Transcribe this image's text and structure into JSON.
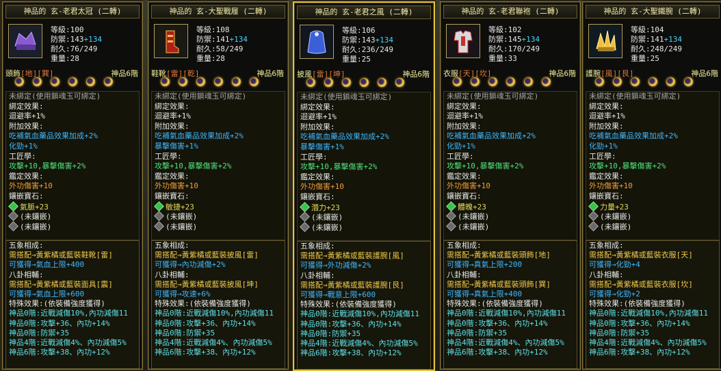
{
  "cards": [
    {
      "title": "神品的 玄-老君太冠 (二轉)",
      "icon": "purple-crown-icon",
      "level": "等級:100",
      "def": "防禦:143",
      "def_plus": "+134",
      "dur": "耐久:76/249",
      "weight": "重量:28",
      "slot": "頭飾",
      "slot_mark": "[地][巽]",
      "tier": "神品6階",
      "unbound": "未綁定(使用鎖魂玉可綁定)",
      "bind_title": "綁定效果:",
      "bind_val": "迴避率+1%",
      "extra_title": "附加效果:",
      "extra_1": "吃補氣血藥品效果加成+2%",
      "extra_2": "化勁+1%",
      "craft_title": "工匠學:",
      "craft_val": "攻擊+10,暴擊傷害+2%",
      "appraise_title": "鑑定效果:",
      "appraise_val": "外功傷害+10",
      "inlay_title": "鑲嵌寶石:",
      "gem1": "氣脈+23",
      "gem2": "(未鑲嵌)",
      "gem3": "(未鑲嵌)",
      "wx_title": "五象相成:",
      "wx_1": "需搭配→黃紫橘或藍裝鞋靴[雷]",
      "wx_2": "可獲得→氣血上限+400",
      "bg_title": "八卦相輔:",
      "bg_1": "需搭配→黃紫橘或藍裝面具[震]",
      "bg_2": "可獲得→氣血上限+600",
      "sp_title": "特殊效果:(依裝備強度獲得)",
      "sp": [
        "神品0階:近戰減傷10%,內功減傷11",
        "神品0階:攻擊+36、內功+14%",
        "神品0階:防禦+35",
        "神品4階:近戰減傷4%、內功減傷5%",
        "神品6階:攻擊+38、內功+12%"
      ]
    },
    {
      "title": "神品的 玄-大聖戰履 (二轉)",
      "icon": "red-boots-icon",
      "level": "等級:108",
      "def": "防禦:141",
      "def_plus": "+134",
      "dur": "耐久:58/249",
      "weight": "重量:28",
      "slot": "鞋靴",
      "slot_mark": "[雷][乾]",
      "tier": "神品6階",
      "unbound": "未綁定(使用鎖魂玉可綁定)",
      "bind_title": "綁定效果:",
      "bind_val": "迴避率+1%",
      "extra_title": "附加效果:",
      "extra_1": "吃補氣血藥品效果加成+2%",
      "extra_2": "暴擊傷害+1%",
      "craft_title": "工匠學:",
      "craft_val": "攻擊+10,暴擊傷害+2%",
      "appraise_title": "鑑定效果:",
      "appraise_val": "外功傷害+10",
      "inlay_title": "鑲嵌寶石:",
      "gem1": "敏捷+23",
      "gem2": "(未鑲嵌)",
      "gem3": "(未鑲嵌)",
      "wx_title": "五象相成:",
      "wx_1": "需搭配→黃紫橘或藍裝披風[雷]",
      "wx_2": "可獲得→內功減傷+2%",
      "bg_title": "八卦相輔:",
      "bg_1": "需搭配→黃紫橘或藍裝披風[坤]",
      "bg_2": "可獲得→攻速+6%",
      "sp_title": "特殊效果:(依裝備強度獲得)",
      "sp": [
        "神品0階:近戰減傷10%,內功減傷11",
        "神品0階:攻擊+36、內功+14%",
        "神品0階:防禦+35",
        "神品4階:近戰減傷4%、內功減傷5%",
        "神品6階:攻擊+38、內功+12%"
      ]
    },
    {
      "title": "神品的 玄-老君之風 (二轉)",
      "icon": "blue-cape-icon",
      "level": "等級:106",
      "def": "防禦:143",
      "def_plus": "+134",
      "dur": "耐久:236/249",
      "weight": "重量:25",
      "slot": "披風",
      "slot_mark": "[雷][坤]",
      "tier": "神品6階",
      "unbound": "未綁定(使用鎖魂玉可綁定)",
      "bind_title": "綁定效果:",
      "bind_val": "迴避率+1%",
      "extra_title": "附加效果:",
      "extra_1": "吃補氣血藥品效果加成+2%",
      "extra_2": "暴擊傷害+1%",
      "craft_title": "工匠學:",
      "craft_val": "攻擊+10,暴擊傷害+2%",
      "appraise_title": "鑑定效果:",
      "appraise_val": "外功傷害+10",
      "inlay_title": "鑲嵌寶石:",
      "gem1": "潛力+23",
      "gem2": "(未鑲嵌)",
      "gem3": "(未鑲嵌)",
      "wx_title": "五象相成:",
      "wx_1": "需搭配→黃紫橘或藍裝護腕[風]",
      "wx_2": "可獲得→外功減傷+2%",
      "bg_title": "八卦相輔:",
      "bg_1": "需搭配→黃紫橘或藍裝護腕[艮]",
      "bg_2": "可獲得→戰意上限+600",
      "sp_title": "特殊效果:(依裝備強度獲得)",
      "sp": [
        "神品0階:近戰減傷10%,內功減傷11",
        "神品0階:攻擊+36、內功+14%",
        "神品0階:防禦+35",
        "神品4階:近戰減傷4%、內功減傷5%",
        "神品6階:攻擊+38、內功+12%"
      ]
    },
    {
      "title": "神品的 玄-老君聯袍 (二轉)",
      "icon": "robe-armor-icon",
      "level": "等級:102",
      "def": "防禦:145",
      "def_plus": "+134",
      "dur": "耐久:170/249",
      "weight": "重量:33",
      "slot": "衣服",
      "slot_mark": "[天][坎]",
      "tier": "神品6階",
      "unbound": "未綁定(使用鎖魂玉可綁定)",
      "bind_title": "綁定效果:",
      "bind_val": "迴避率+1%",
      "extra_title": "附加效果:",
      "extra_1": "吃補氣血藥品效果加成+2%",
      "extra_2": "化勁+1%",
      "craft_title": "工匠學:",
      "craft_val": "攻擊+10,暴擊傷害+2%",
      "appraise_title": "鑑定效果:",
      "appraise_val": "外功傷害+10",
      "inlay_title": "鑲嵌寶石:",
      "gem1": "體魄+23",
      "gem2": "(未鑲嵌)",
      "gem3": "(未鑲嵌)",
      "wx_title": "五象相成:",
      "wx_1": "需搭配→黃紫橘或藍裝頭飾[地]",
      "wx_2": "可獲得→真氣上限+200",
      "bg_title": "八卦相輔:",
      "bg_1": "需搭配→黃紫橘或藍裝頭飾[巽]",
      "bg_2": "可獲得→真氣上限+400",
      "sp_title": "特殊效果:(依裝備強度獲得)",
      "sp": [
        "神品0階:近戰減傷10%,內功減傷11",
        "神品0階:攻擊+36、內功+14%",
        "神品0階:防禦+35",
        "神品4階:近戰減傷4%、內功減傷5%",
        "神品6階:攻擊+38、內功+12%"
      ]
    },
    {
      "title": "神品的 玄-大聖鐵腕 (二轉)",
      "icon": "gold-gauntlet-icon",
      "level": "等級:104",
      "def": "防禦:141",
      "def_plus": "+134",
      "dur": "耐久:248/249",
      "weight": "重量:25",
      "slot": "護腕",
      "slot_mark": "[風][艮]",
      "tier": "神品6階",
      "unbound": "未綁定(使用鎖魂玉可綁定)",
      "bind_title": "綁定效果:",
      "bind_val": "迴避率+1%",
      "extra_title": "附加效果:",
      "extra_1": "吃補氣血藥品效果加成+2%",
      "extra_2": "化勁+1%",
      "craft_title": "工匠學:",
      "craft_val": "攻擊+10,暴擊傷害+2%",
      "appraise_title": "鑑定效果:",
      "appraise_val": "外功傷害+10",
      "inlay_title": "鑲嵌寶石:",
      "gem1": "力量+23",
      "gem2": "(未鑲嵌)",
      "gem3": "(未鑲嵌)",
      "wx_title": "五象相成:",
      "wx_1": "需搭配→黃紫橘或藍裝衣服[天]",
      "wx_2": "可獲得→化勁+4",
      "bg_title": "八卦相輔:",
      "bg_1": "需搭配→黃紫橘或藍裝衣服[坎]",
      "bg_2": "可獲得→化勁+2",
      "sp_title": "特殊效果:(依裝備強度獲得)",
      "sp": [
        "神品0階:近戰減傷10%,內功減傷11",
        "神品0階:攻擊+36、內功+14%",
        "神品0階:防禦+35",
        "神品4階:近戰減傷4%、內功減傷5%",
        "神品6階:攻擊+38、內功+12%"
      ]
    }
  ]
}
